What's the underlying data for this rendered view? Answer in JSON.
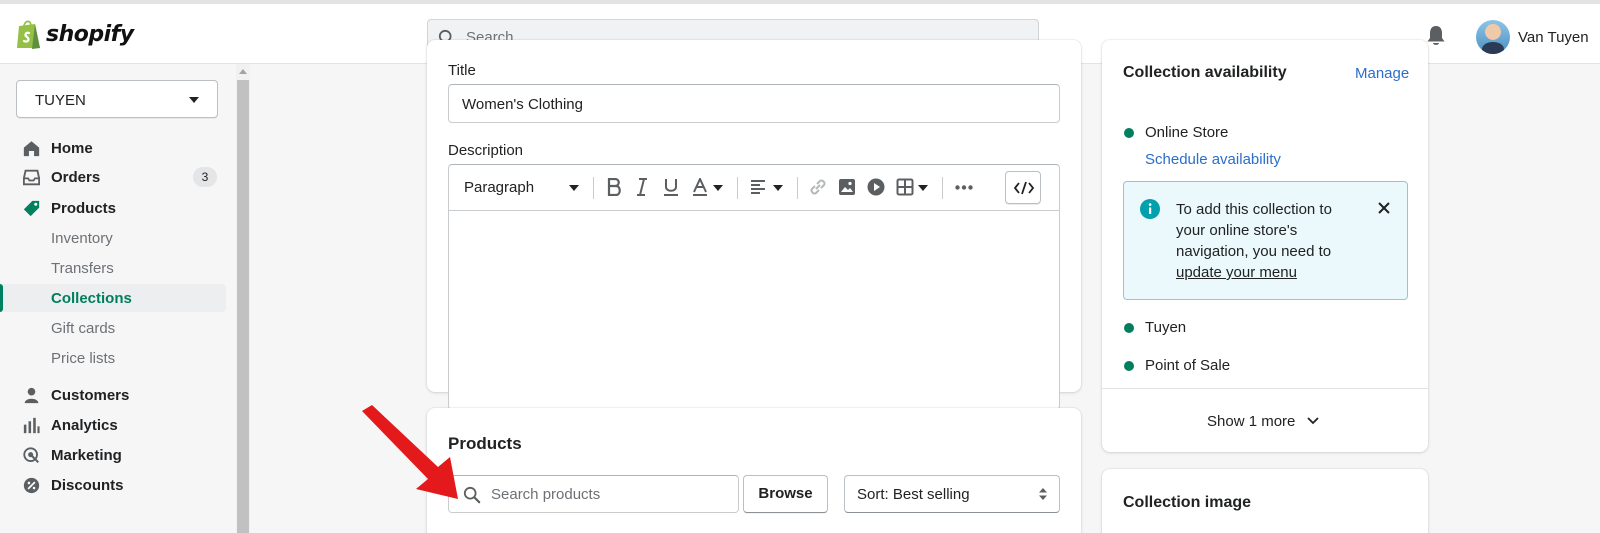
{
  "topbar": {
    "logo_text": "shopify",
    "search_placeholder": "Search",
    "user_name": "Van Tuyen"
  },
  "sidebar": {
    "store_name": "TUYEN",
    "items": [
      {
        "label": "Home",
        "icon": "home-icon"
      },
      {
        "label": "Orders",
        "icon": "orders-icon",
        "badge": "3"
      },
      {
        "label": "Products",
        "icon": "tag-icon"
      }
    ],
    "product_subitems": [
      {
        "label": "Inventory"
      },
      {
        "label": "Transfers"
      },
      {
        "label": "Collections",
        "active": true
      },
      {
        "label": "Gift cards"
      },
      {
        "label": "Price lists"
      }
    ],
    "items_bottom": [
      {
        "label": "Customers",
        "icon": "person-icon"
      },
      {
        "label": "Analytics",
        "icon": "bar-chart-icon"
      },
      {
        "label": "Marketing",
        "icon": "target-icon"
      },
      {
        "label": "Discounts",
        "icon": "discount-icon"
      }
    ]
  },
  "collection_form": {
    "title_label": "Title",
    "title_value": "Women's Clothing",
    "description_label": "Description",
    "paragraph_select": "Paragraph"
  },
  "products_card": {
    "heading": "Products",
    "search_placeholder": "Search products",
    "browse_label": "Browse",
    "sort_label": "Sort: Best selling"
  },
  "availability": {
    "heading": "Collection availability",
    "manage_link": "Manage",
    "channels": [
      "Online Store",
      "Tuyen",
      "Point of Sale"
    ],
    "schedule_link": "Schedule availability",
    "banner_text": "To add this collection to your online store's navigation, you need to",
    "banner_link": "update your menu",
    "show_more": "Show 1 more"
  },
  "collection_image": {
    "heading": "Collection image"
  },
  "colors": {
    "accent_green": "#008060",
    "link_blue": "#2c6ecb",
    "banner_bg": "#ebf9fc",
    "annotation_arrow": "#e3191c"
  }
}
